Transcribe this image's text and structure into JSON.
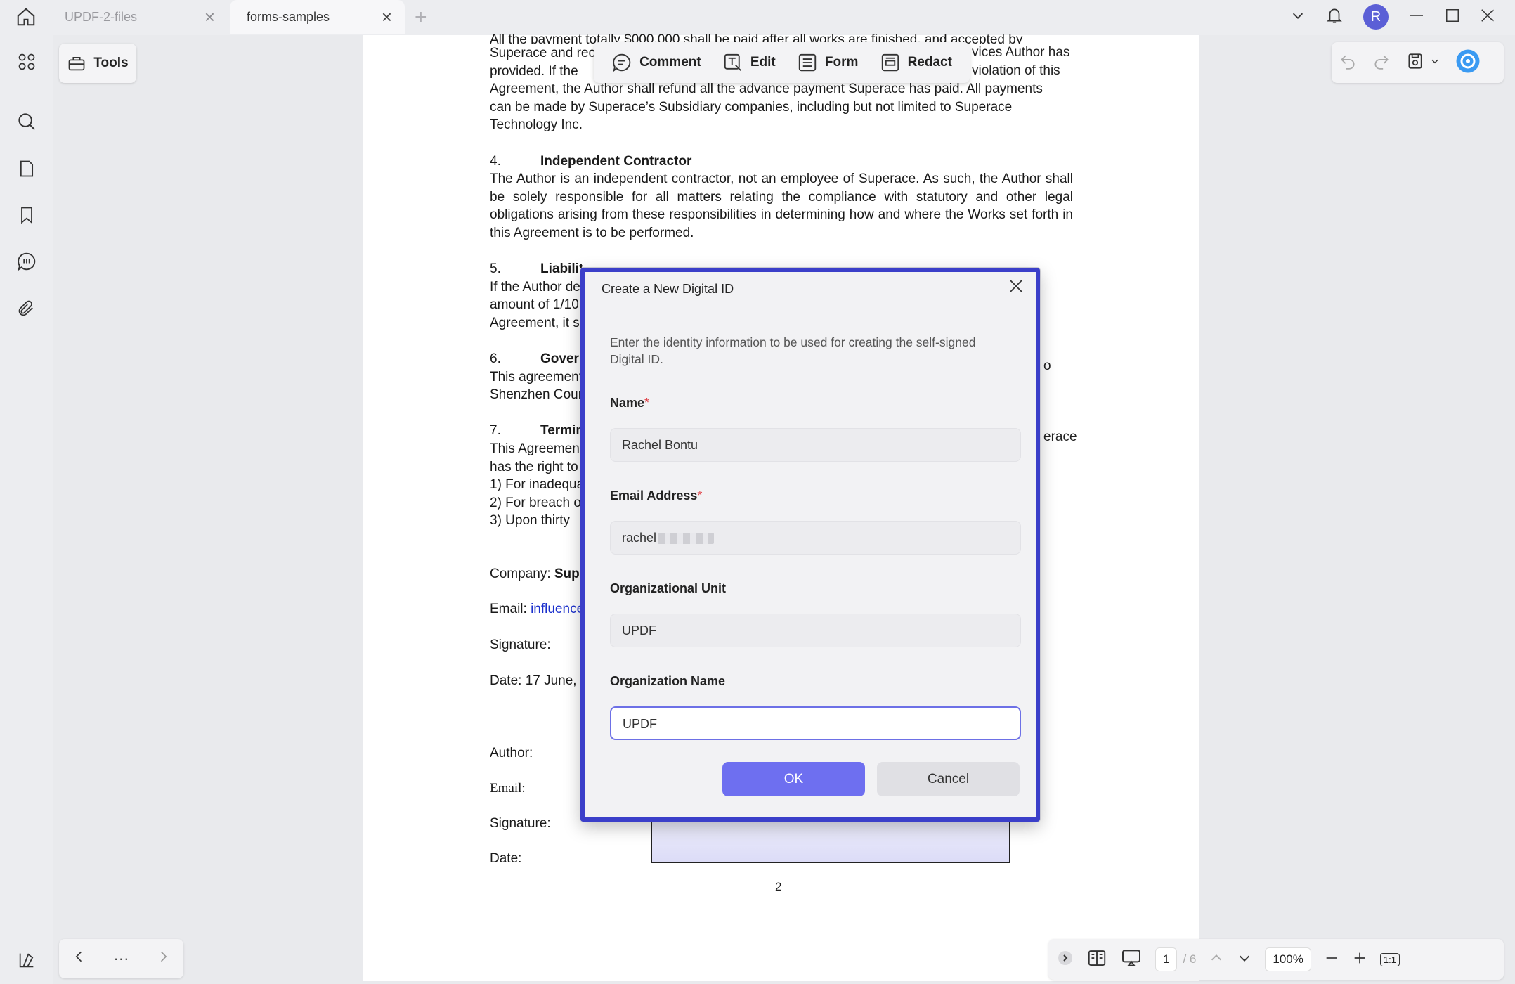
{
  "tabs": [
    {
      "label": "UPDF-2-files"
    },
    {
      "label": "forms-samples"
    }
  ],
  "avatar_letter": "R",
  "toolbar": {
    "tools_label": "Tools",
    "items": [
      {
        "label": "Comment",
        "icon": "comment-icon"
      },
      {
        "label": "Edit",
        "icon": "edit-text-icon"
      },
      {
        "label": "Form",
        "icon": "form-icon"
      },
      {
        "label": "Redact",
        "icon": "redact-icon"
      }
    ]
  },
  "document": {
    "para3_lines": [
      "All the payment totally $000,000 shall be paid after all works are finished, and accepted by",
      "Superace and rec",
      "provided. If the",
      "Agreement, the Author shall refund all the advance payment Superace has paid. All payments",
      "can be made by Superace’s Subsidiary companies, including but not limited to Superace",
      "Technology Inc."
    ],
    "para3_right": [
      "vices Author has",
      "violation of this"
    ],
    "s4_num": "4.",
    "s4_title": "Independent Contractor",
    "s4_text": "The Author is an independent contractor, not an employee of Superace. As such, the Author shall be solely responsible for all matters relating the compliance with statutory and other legal obligations arising from these responsibilities in determining how and where the Works set forth in this Agreement is to be performed.",
    "s5_num": "5.",
    "s5_title": "Liabilit",
    "s5_lines": [
      "If the Author de",
      "amount of 1/10",
      "Agreement, it s"
    ],
    "s6_num": "6.",
    "s6_title": "Gover",
    "s6_lines": [
      "This agreement",
      "Shenzhen Cour"
    ],
    "s6_right": "o",
    "s7_num": "7.",
    "s7_title": "Termin",
    "s7_lines": [
      "This Agreemen",
      "has the right to",
      "1) For inadequa",
      "2) For breach o",
      "3)  Upon thirty"
    ],
    "s7_right": "erace",
    "company_label": "Company: ",
    "company_value": "Supe",
    "email_label": "Email: ",
    "email_value": "influence",
    "signature_label": "Signature:",
    "date_label": "Date: 17 June, ",
    "author_label": "Author:",
    "email2_label": "Email:",
    "signature2_label": "Signature:",
    "date2_label": "Date:",
    "page_number": "2"
  },
  "dialog": {
    "title": "Create a New Digital ID",
    "description": "Enter the identity information to be used for creating the self-signed Digital ID.",
    "name_label": "Name",
    "name_value": "Rachel Bontu",
    "email_label": "Email Address",
    "email_value": "rachel",
    "org_unit_label": "Organizational Unit",
    "org_unit_value": "UPDF",
    "org_name_label": "Organization Name",
    "org_name_value": "UPDF",
    "required_mark": "*",
    "ok_label": "OK",
    "cancel_label": "Cancel"
  },
  "bottom": {
    "more_label": "···",
    "current_page": "1",
    "total_pages": "/ 6",
    "zoom": "100%",
    "fit_label": "1:1"
  },
  "colors": {
    "accent": "#6e6ff0",
    "dialog_border": "#3b3fc9",
    "avatar": "#5b5fd6"
  }
}
